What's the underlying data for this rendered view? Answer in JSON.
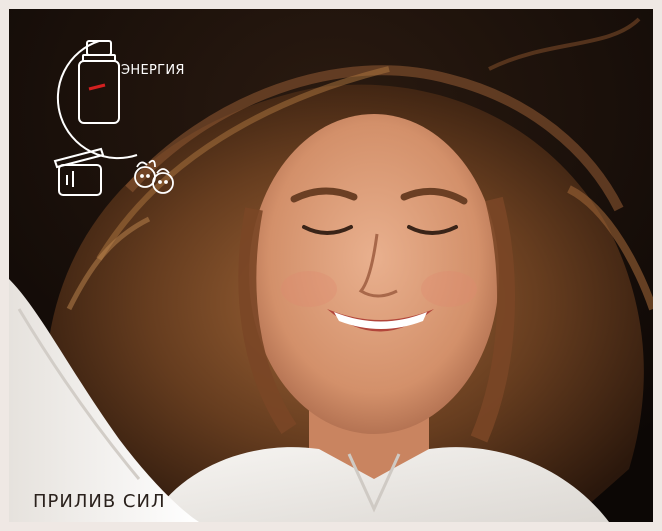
{
  "badge": {
    "label": "ЭНЕРГИЯ",
    "bottle_icon": "oil-bottle-icon",
    "diffuser_icon": "diffuser-icon",
    "kids_icon": "kids-faces-icon",
    "color": "#ffffff"
  },
  "caption": {
    "text": "ПРИЛИВ СИЛ"
  },
  "colors": {
    "frame": "#efe8e4",
    "background": "#120c08",
    "bottle_accent": "#d32020",
    "caption": "#2a211c"
  }
}
